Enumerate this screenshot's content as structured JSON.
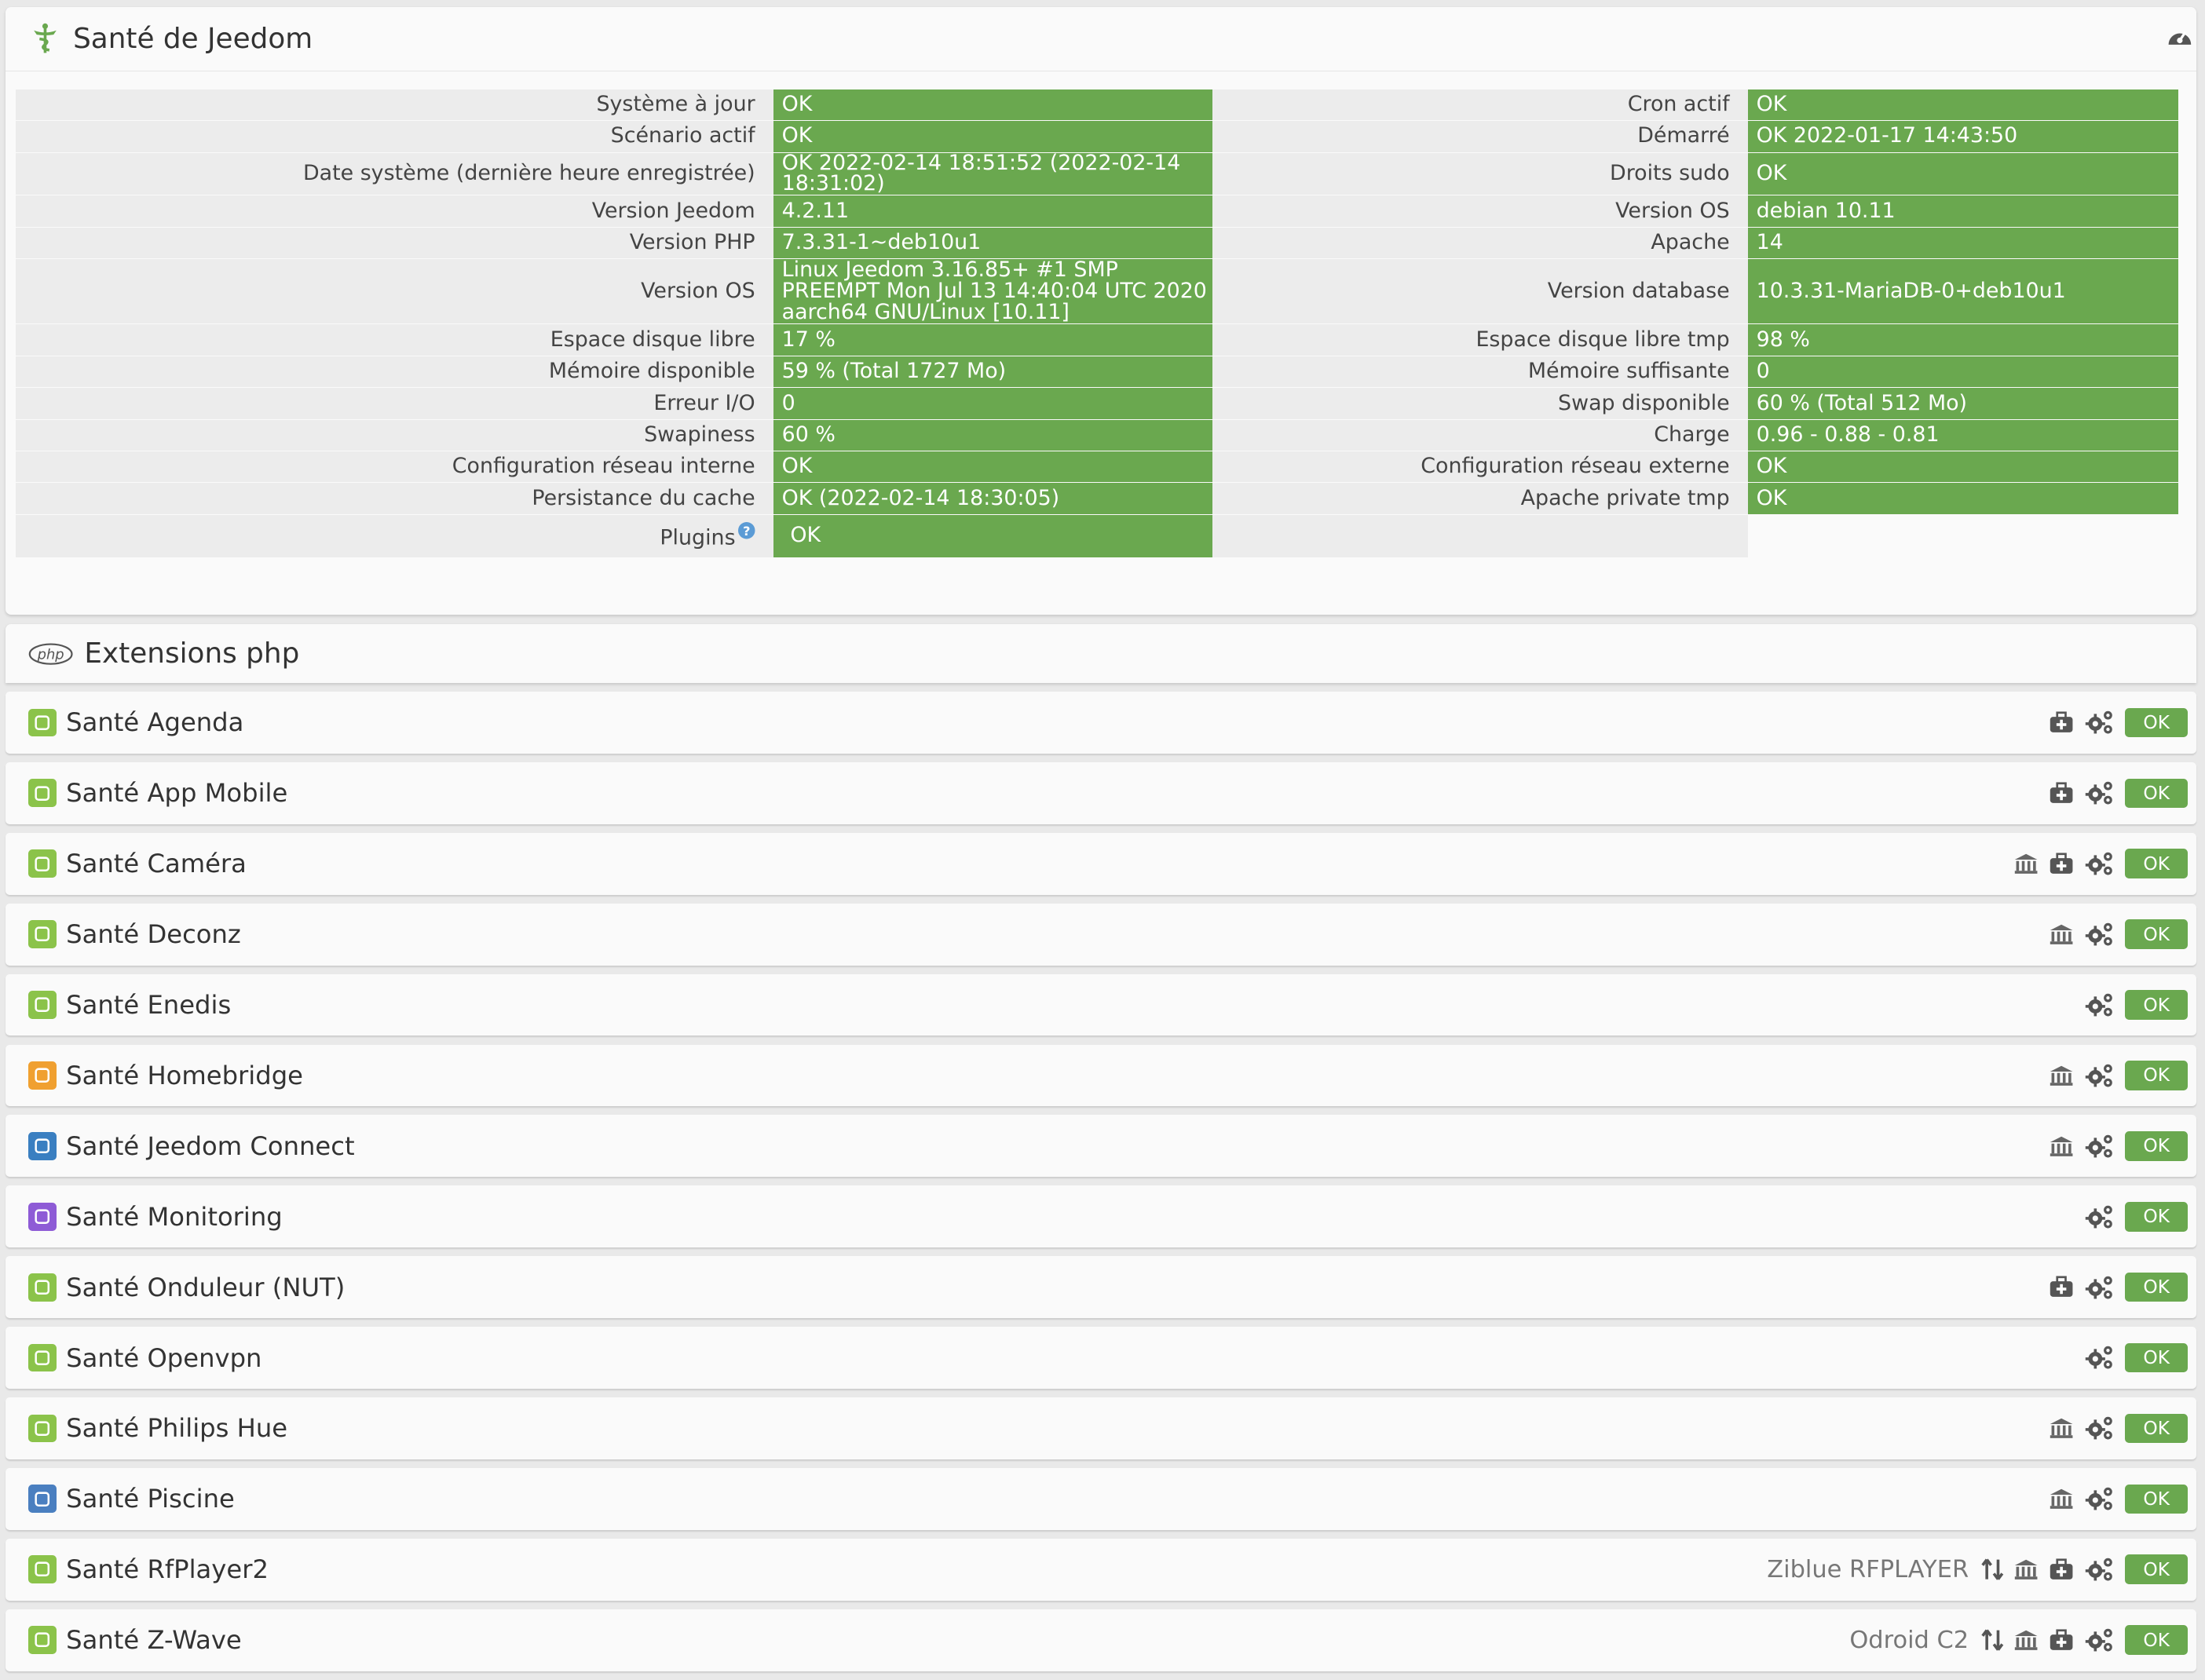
{
  "health": {
    "title": "Santé de Jeedom",
    "rows": [
      {
        "l1": "Système à jour",
        "v1": "OK",
        "l2": "Cron actif",
        "v2": "OK"
      },
      {
        "l1": "Scénario actif",
        "v1": "OK",
        "l2": "Démarré",
        "v2": "OK 2022-01-17 14:43:50"
      },
      {
        "l1": "Date système (dernière heure enregistrée)",
        "v1": "OK 2022-02-14 18:51:52 (2022-02-14 18:31:02)",
        "l2": "Droits sudo",
        "v2": "OK"
      },
      {
        "l1": "Version Jeedom",
        "v1": "4.2.11",
        "l2": "Version OS",
        "v2": "debian 10.11"
      },
      {
        "l1": "Version PHP",
        "v1": "7.3.31-1~deb10u1",
        "l2": "Apache",
        "v2": "14"
      },
      {
        "l1": "Version OS",
        "v1": "Linux Jeedom 3.16.85+ #1 SMP PREEMPT Mon Jul 13 14:40:04 UTC 2020 aarch64 GNU/Linux [10.11]",
        "l2": "Version database",
        "v2": "10.3.31-MariaDB-0+deb10u1"
      },
      {
        "l1": "Espace disque libre",
        "v1": "17 %",
        "l2": "Espace disque libre tmp",
        "v2": "98 %"
      },
      {
        "l1": "Mémoire disponible",
        "v1": "59 % (Total 1727 Mo)",
        "l2": "Mémoire suffisante",
        "v2": "0"
      },
      {
        "l1": "Erreur I/O",
        "v1": "0",
        "l2": "Swap disponible",
        "v2": "60 % (Total 512 Mo)"
      },
      {
        "l1": "Swapiness",
        "v1": "60 %",
        "l2": "Charge",
        "v2": "0.96 - 0.88 - 0.81"
      },
      {
        "l1": "Configuration réseau interne",
        "v1": "OK",
        "l2": "Configuration réseau externe",
        "v2": "OK"
      },
      {
        "l1": "Persistance du cache",
        "v1": "OK (2022-02-14 18:30:05)",
        "l2": "Apache private tmp",
        "v2": "OK"
      }
    ],
    "plugins_label": "Plugins",
    "plugins_value": "OK"
  },
  "php": {
    "title": "Extensions php",
    "logo": "php"
  },
  "plugins": [
    {
      "name": "Santé Agenda",
      "device": "",
      "status": "OK",
      "color": "#8bc34a",
      "icon": "calendar-icon"
    },
    {
      "name": "Santé App Mobile",
      "device": "",
      "status": "OK",
      "color": "#8bc34a",
      "icon": "mobile-icon"
    },
    {
      "name": "Santé Caméra",
      "device": "",
      "status": "OK",
      "color": "#8bc34a",
      "icon": "camera-icon"
    },
    {
      "name": "Santé Deconz",
      "device": "",
      "status": "OK",
      "color": "#8bc34a",
      "icon": "deconz-icon"
    },
    {
      "name": "Santé Enedis",
      "device": "",
      "status": "OK",
      "color": "#8bc34a",
      "icon": "enedis-icon"
    },
    {
      "name": "Santé Homebridge",
      "device": "",
      "status": "OK",
      "color": "#f0a030",
      "icon": "homebridge-icon"
    },
    {
      "name": "Santé Jeedom Connect",
      "device": "",
      "status": "OK",
      "color": "#3a7fc1",
      "icon": "jeedom-connect-icon"
    },
    {
      "name": "Santé Monitoring",
      "device": "",
      "status": "OK",
      "color": "#8e5bd6",
      "icon": "monitoring-icon"
    },
    {
      "name": "Santé Onduleur (NUT)",
      "device": "",
      "status": "OK",
      "color": "#8bc34a",
      "icon": "ups-icon"
    },
    {
      "name": "Santé Openvpn",
      "device": "",
      "status": "OK",
      "color": "#8bc34a",
      "icon": "openvpn-icon"
    },
    {
      "name": "Santé Philips Hue",
      "device": "",
      "status": "OK",
      "color": "#8bc34a",
      "icon": "hue-icon"
    },
    {
      "name": "Santé Piscine",
      "device": "",
      "status": "OK",
      "color": "#4a7fc0",
      "icon": "pool-icon"
    },
    {
      "name": "Santé RfPlayer2",
      "device": "Ziblue RFPLAYER",
      "status": "OK",
      "color": "#8bc34a",
      "icon": "rfplayer-icon"
    },
    {
      "name": "Santé Z-Wave",
      "device": "Odroid C2",
      "status": "OK",
      "color": "#8bc34a",
      "icon": "zwave-icon"
    }
  ],
  "colors": {
    "ok_green": "#6aa84f",
    "label_bg": "#ececec",
    "panel_bg": "#fafafa"
  }
}
